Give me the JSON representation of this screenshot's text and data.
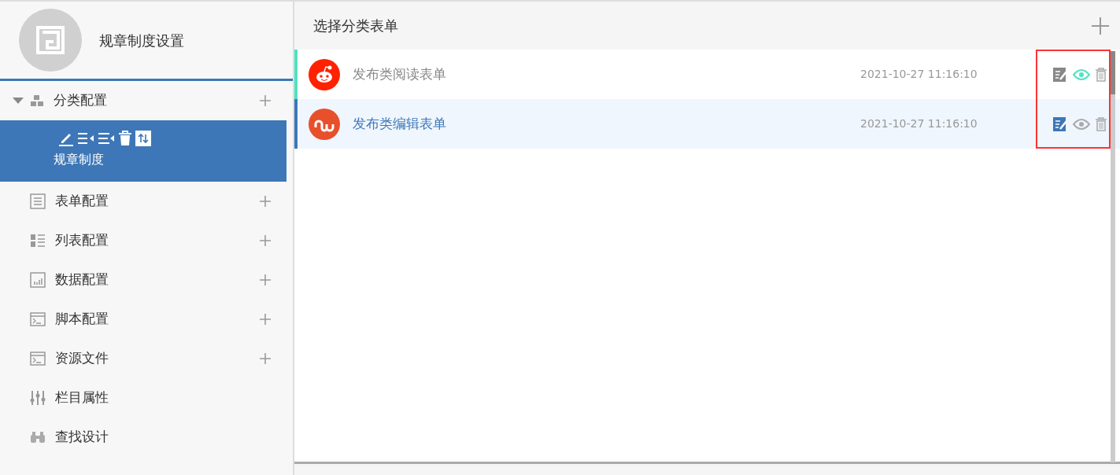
{
  "sidebar": {
    "title": "规章制度设置",
    "items": [
      {
        "kind": "category",
        "label": "分类配置",
        "addable": true,
        "expanded": true,
        "children": [
          {
            "label": "规章制度",
            "selected": true
          }
        ]
      },
      {
        "kind": "form",
        "label": "表单配置",
        "addable": true
      },
      {
        "kind": "list",
        "label": "列表配置",
        "addable": true
      },
      {
        "kind": "data",
        "label": "数据配置",
        "addable": true
      },
      {
        "kind": "script",
        "label": "脚本配置",
        "addable": true
      },
      {
        "kind": "script",
        "label": "资源文件",
        "addable": true
      },
      {
        "kind": "column",
        "label": "栏目属性",
        "addable": false
      },
      {
        "kind": "search",
        "label": "查找设计",
        "addable": false
      }
    ]
  },
  "panel": {
    "title": "选择分类表单",
    "rows": [
      {
        "kind": "reddit",
        "name": "发布类阅读表单",
        "time": "2021-10-27 11:16:10",
        "selected": false,
        "hovered": true
      },
      {
        "kind": "stumble",
        "name": "发布类编辑表单",
        "time": "2021-10-27 11:16:10",
        "selected": true,
        "hovered": false
      }
    ],
    "actions_highlighted": true
  }
}
